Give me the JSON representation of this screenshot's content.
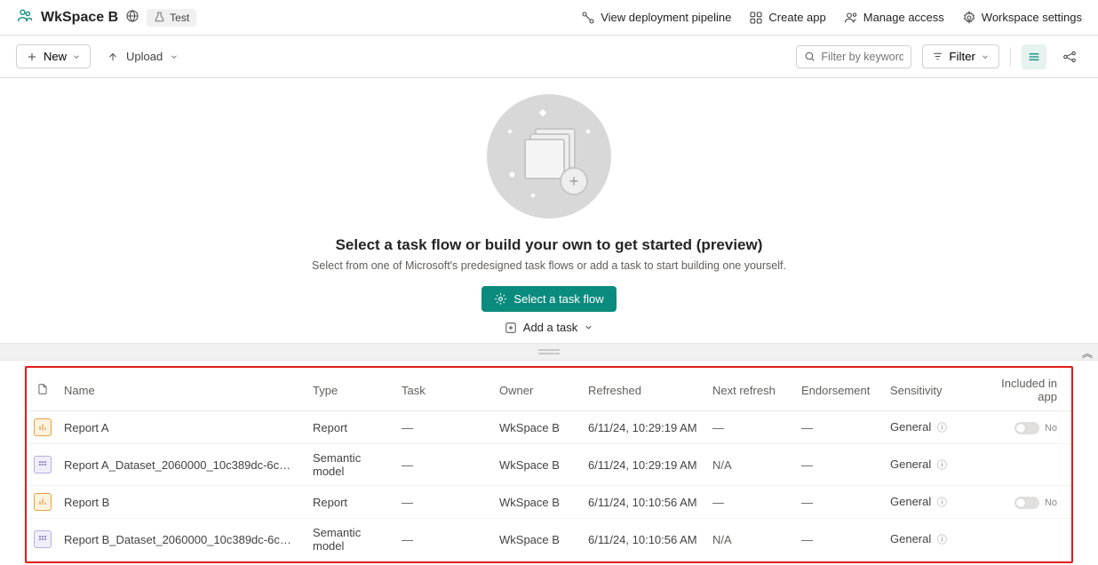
{
  "header": {
    "workspace_name": "WkSpace B",
    "test_badge": "Test",
    "links": {
      "pipeline": "View deployment pipeline",
      "create_app": "Create app",
      "manage_access": "Manage access",
      "settings": "Workspace settings"
    }
  },
  "toolbar": {
    "new_label": "New",
    "upload_label": "Upload",
    "search_placeholder": "Filter by keyword",
    "filter_label": "Filter"
  },
  "hero": {
    "title": "Select a task flow or build your own to get started (preview)",
    "subtitle": "Select from one of Microsoft's predesigned task flows or add a task to start building one yourself.",
    "select_button": "Select a task flow",
    "add_task": "Add a task"
  },
  "table": {
    "columns": {
      "name": "Name",
      "type": "Type",
      "task": "Task",
      "owner": "Owner",
      "refreshed": "Refreshed",
      "next_refresh": "Next refresh",
      "endorsement": "Endorsement",
      "sensitivity": "Sensitivity",
      "included": "Included in app"
    },
    "rows": [
      {
        "icon_type": "report",
        "name": "Report A",
        "type": "Report",
        "task": "—",
        "owner": "WkSpace B",
        "refreshed": "6/11/24, 10:29:19 AM",
        "next_refresh": "—",
        "endorsement": "—",
        "sensitivity": "General",
        "included_toggle": true,
        "included_label": "No"
      },
      {
        "icon_type": "semantic",
        "name": "Report A_Dataset_2060000_10c389dc-6c27-ef11-840a-00...",
        "type": "Semantic model",
        "task": "—",
        "owner": "WkSpace B",
        "refreshed": "6/11/24, 10:29:19 AM",
        "next_refresh": "N/A",
        "endorsement": "—",
        "sensitivity": "General",
        "included_toggle": false,
        "included_label": ""
      },
      {
        "icon_type": "report",
        "name": "Report B",
        "type": "Report",
        "task": "—",
        "owner": "WkSpace B",
        "refreshed": "6/11/24, 10:10:56 AM",
        "next_refresh": "—",
        "endorsement": "—",
        "sensitivity": "General",
        "included_toggle": true,
        "included_label": "No"
      },
      {
        "icon_type": "semantic",
        "name": "Report B_Dataset_2060000_10c389dc-6c27-ef11-840a-00...",
        "type": "Semantic model",
        "task": "—",
        "owner": "WkSpace B",
        "refreshed": "6/11/24, 10:10:56 AM",
        "next_refresh": "N/A",
        "endorsement": "—",
        "sensitivity": "General",
        "included_toggle": false,
        "included_label": ""
      }
    ]
  }
}
